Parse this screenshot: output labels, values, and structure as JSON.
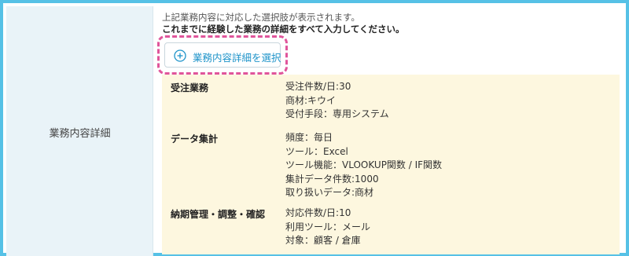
{
  "row_label": "業務内容詳細",
  "description": {
    "line1": "上記業務内容に対応した選択肢が表示されます。",
    "line2": "これまでに経験した業務の詳細をすべて入力してください。"
  },
  "select_button": {
    "label": "業務内容詳細を選択",
    "icon": "plus-circle-icon"
  },
  "colors": {
    "frame_border": "#56c1e6",
    "label_bg": "#e9f3f8",
    "highlight_dash": "#e0559b",
    "accent": "#1d93c9",
    "panel_bg": "#fdf7df"
  },
  "entries": [
    {
      "category": "受注業務",
      "details": [
        "受注件数/日:30",
        "商材:キウイ",
        "受付手段：専用システム"
      ]
    },
    {
      "category": "データ集計",
      "details": [
        "頻度：毎日",
        "ツール：Excel",
        "ツール機能：VLOOKUP関数 / IF関数",
        "集計データ件数:1000",
        "取り扱いデータ:商材"
      ]
    },
    {
      "category": "納期管理・調整・確認",
      "details": [
        "対応件数/日:10",
        "利用ツール：メール",
        "対象：顧客 / 倉庫"
      ]
    }
  ]
}
